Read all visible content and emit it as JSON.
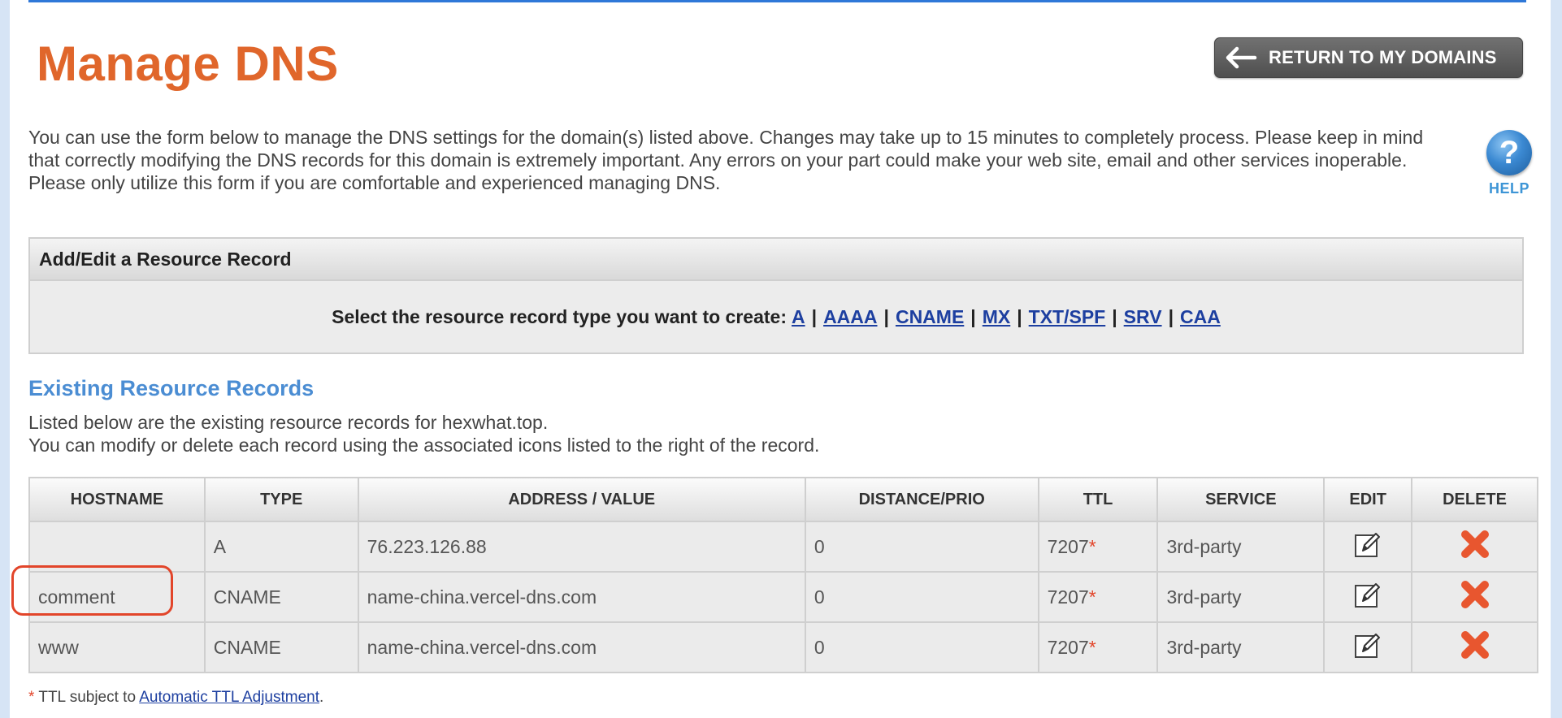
{
  "header": {
    "title": "Manage DNS",
    "return_button": "RETURN TO MY DOMAINS"
  },
  "intro": "You can use the form below to manage the DNS settings for the domain(s) listed above. Changes may take up to 15 minutes to completely process. Please keep in mind that correctly modifying the DNS records for this domain is extremely important. Any errors on your part could make your web site, email and other services inoperable. Please only utilize this form if you are comfortable and experienced managing DNS.",
  "help": {
    "icon_glyph": "?",
    "label": "HELP"
  },
  "add_edit": {
    "title": "Add/Edit a Resource Record",
    "prompt": "Select the resource record type you want to create:",
    "types": [
      "A",
      "AAAA",
      "CNAME",
      "MX",
      "TXT/SPF",
      "SRV",
      "CAA"
    ],
    "separator": "|"
  },
  "existing": {
    "title": "Existing Resource Records",
    "desc_line1": "Listed below are the existing resource records for hexwhat.top.",
    "desc_line2": "You can modify or delete each record using the associated icons listed to the right of the record."
  },
  "table": {
    "headers": [
      "HOSTNAME",
      "TYPE",
      "ADDRESS / VALUE",
      "DISTANCE/PRIO",
      "TTL",
      "SERVICE",
      "EDIT",
      "DELETE"
    ],
    "rows": [
      {
        "hostname": "",
        "type": "A",
        "value": "76.223.126.88",
        "distance": "0",
        "ttl": "7207",
        "ttl_mark": "*",
        "service": "3rd-party"
      },
      {
        "hostname": "comment",
        "type": "CNAME",
        "value": "name-china.vercel-dns.com",
        "distance": "0",
        "ttl": "7207",
        "ttl_mark": "*",
        "service": "3rd-party"
      },
      {
        "hostname": "www",
        "type": "CNAME",
        "value": "name-china.vercel-dns.com",
        "distance": "0",
        "ttl": "7207",
        "ttl_mark": "*",
        "service": "3rd-party"
      }
    ]
  },
  "footnote": {
    "star": "*",
    "text": " TTL subject to ",
    "link": "Automatic TTL Adjustment",
    "end": "."
  },
  "colors": {
    "title": "#e0662b",
    "section_title": "#4b8dd3",
    "link": "#1d3fa0",
    "delete_icon": "#e8562f",
    "highlight": "#e2452a"
  },
  "icons": {
    "return": "arrow-left-icon",
    "help": "question-icon",
    "edit": "edit-pencil-icon",
    "delete": "delete-x-icon"
  }
}
